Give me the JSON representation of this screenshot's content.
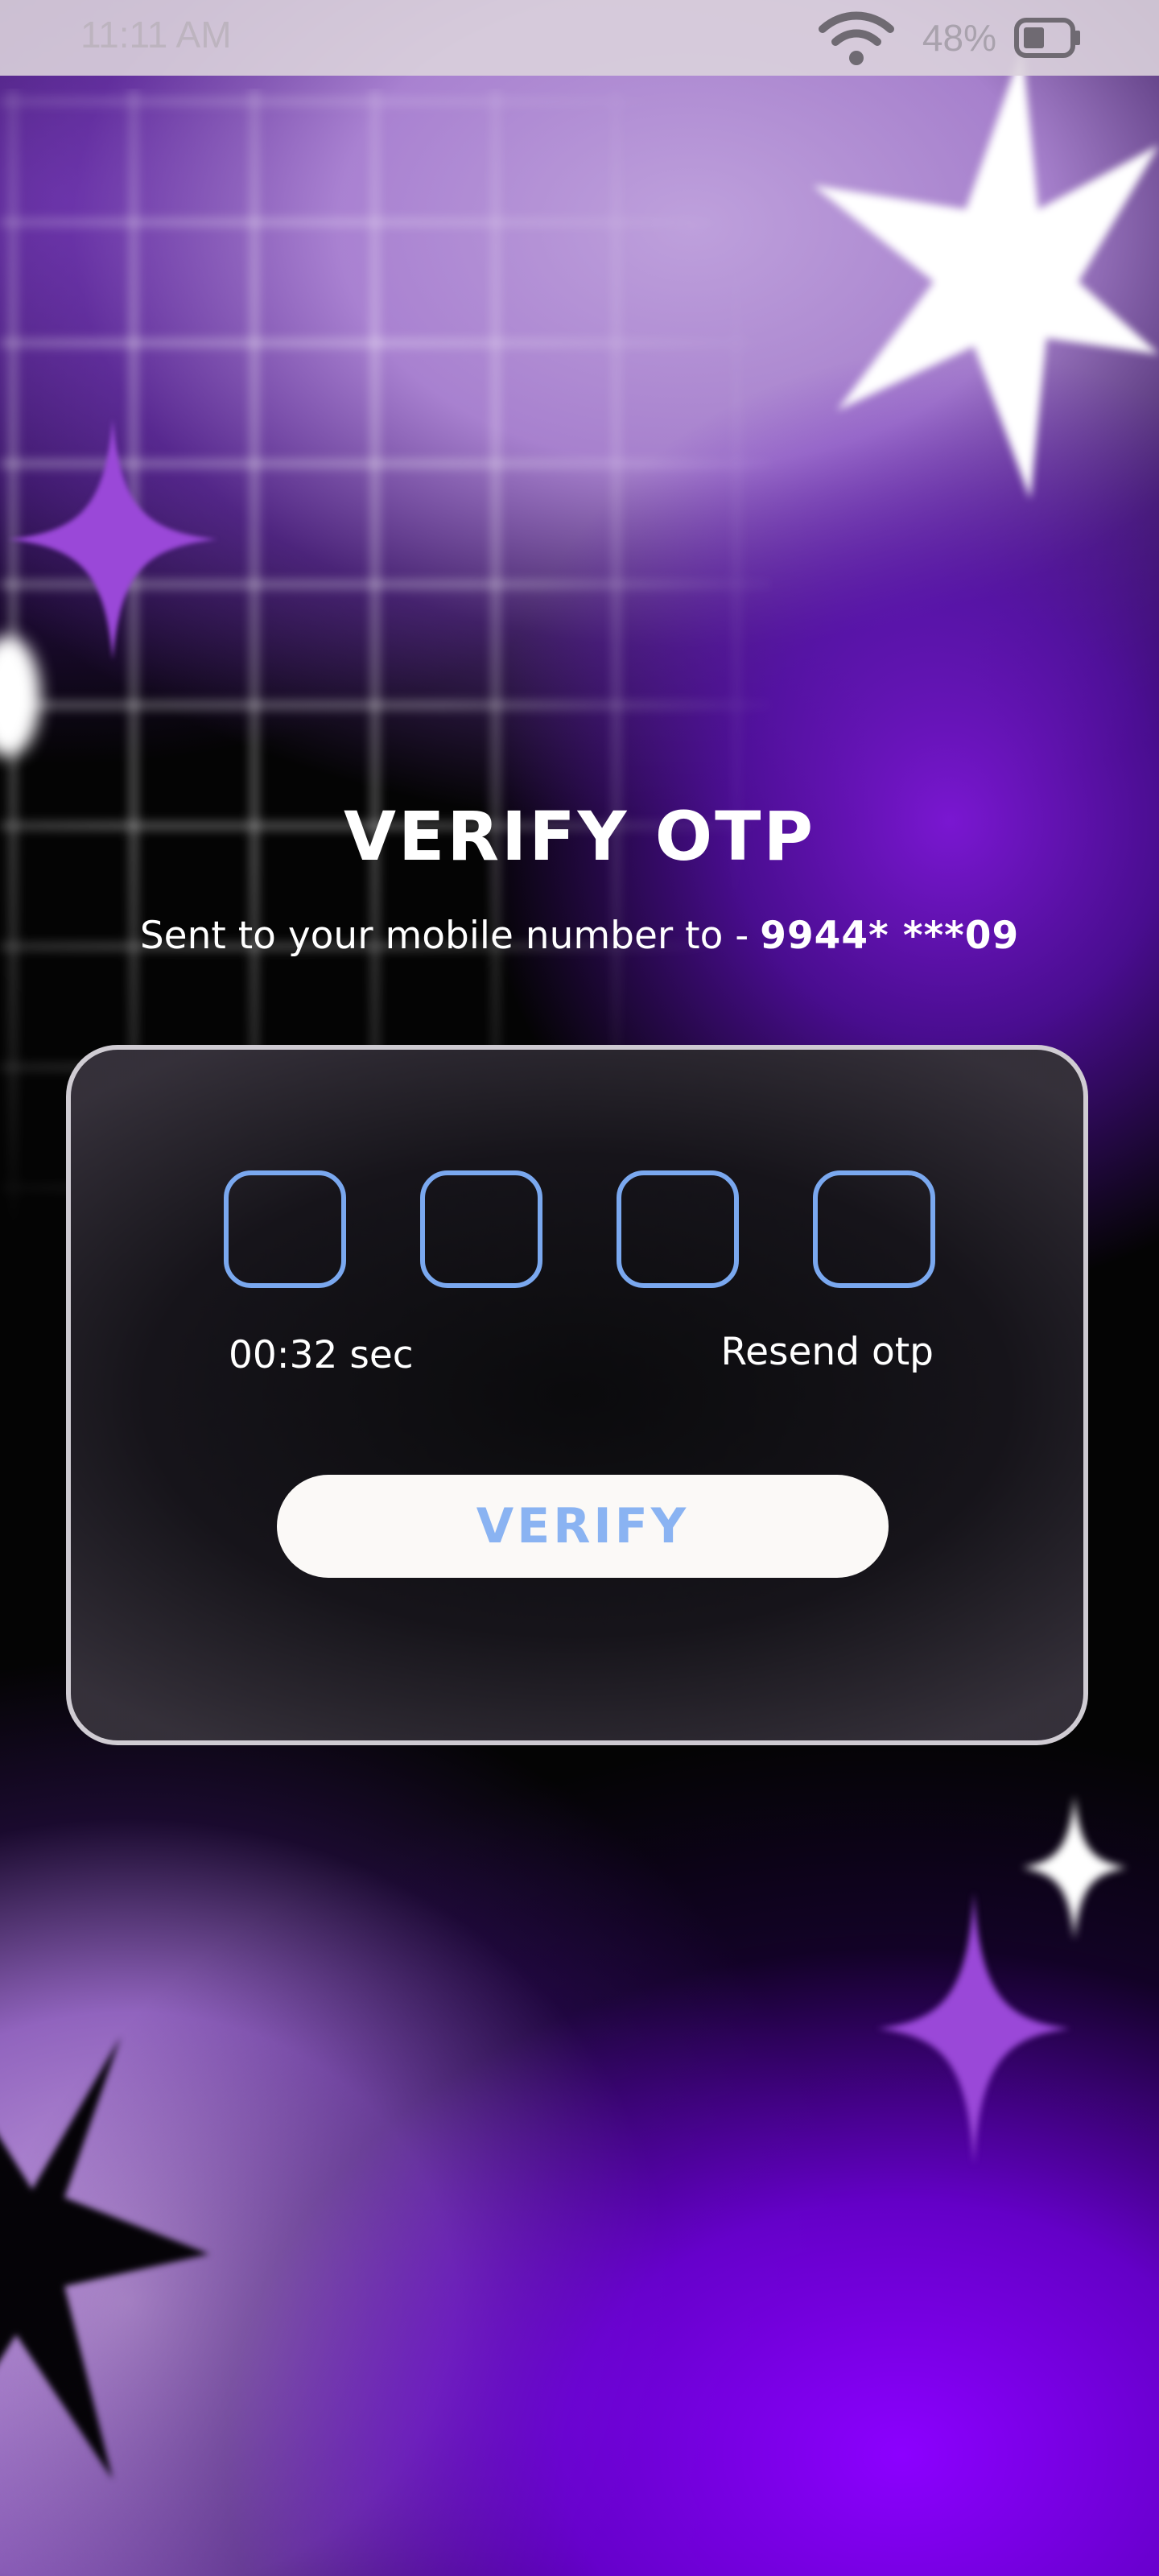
{
  "status_bar": {
    "time": "11:11 AM",
    "battery_percent": "48%",
    "battery_level": 0.48,
    "icons": [
      "wifi-icon",
      "battery-icon"
    ]
  },
  "header": {
    "title": "VERIFY OTP",
    "subtitle_prefix": "Sent to your mobile number to -",
    "masked_number": "9944* ***09"
  },
  "otp": {
    "digits": [
      "",
      "",
      "",
      ""
    ],
    "timer": "00:32 sec",
    "resend_label": "Resend otp",
    "verify_label": "VERIFY"
  },
  "colors": {
    "accent_blue": "#7aa8ef",
    "button_bg": "#fbf9f7",
    "purple": "#8a17e0"
  }
}
